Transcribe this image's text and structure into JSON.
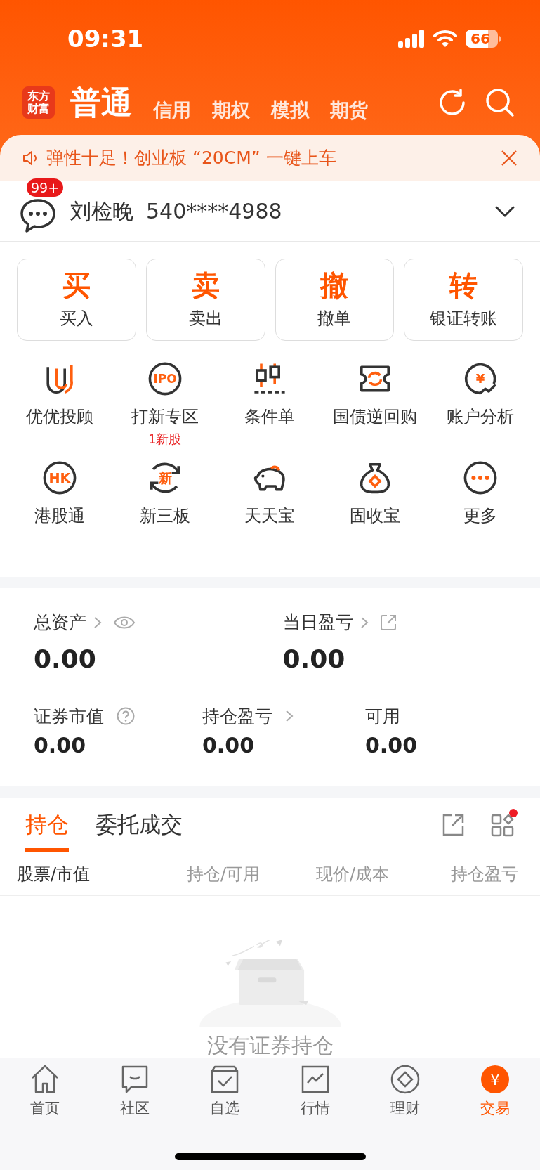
{
  "status_bar": {
    "time": "09:31",
    "battery": "66"
  },
  "account_tabs": [
    {
      "label": "普通",
      "selected": true
    },
    {
      "label": "信用",
      "selected": false
    },
    {
      "label": "期权",
      "selected": false
    },
    {
      "label": "模拟",
      "selected": false
    },
    {
      "label": "期货",
      "selected": false
    }
  ],
  "logo": {
    "line_1": "东方",
    "line_2": "财富"
  },
  "banner": {
    "text": "弹性十足！创业板 “20CM” 一键上车"
  },
  "account": {
    "badge": "99+",
    "name": "刘检晚",
    "number": "540****4988"
  },
  "trade_buttons": [
    {
      "glyph": "买",
      "label": "买入"
    },
    {
      "glyph": "卖",
      "label": "卖出"
    },
    {
      "glyph": "撤",
      "label": "撤单"
    },
    {
      "glyph": "转",
      "label": "银证转账"
    }
  ],
  "services": [
    {
      "label": "优优投顾"
    },
    {
      "label": "打新专区",
      "note": "1新股",
      "icon_text": "IPO"
    },
    {
      "label": "条件单"
    },
    {
      "label": "国债逆回购"
    },
    {
      "label": "账户分析",
      "icon_text": "¥"
    },
    {
      "label": "港股通",
      "icon_text": "HK"
    },
    {
      "label": "新三板",
      "icon_text": "新"
    },
    {
      "label": "天天宝"
    },
    {
      "label": "固收宝"
    },
    {
      "label": "更多"
    }
  ],
  "assets": {
    "top": [
      {
        "label": "总资产",
        "value": "0.00"
      },
      {
        "label": "当日盈亏",
        "value": "0.00"
      }
    ],
    "bottom": [
      {
        "label": "证券市值",
        "value": "0.00"
      },
      {
        "label": "持仓盈亏",
        "value": "0.00"
      },
      {
        "label": "可用",
        "value": "0.00"
      }
    ]
  },
  "holdings_tabs": [
    {
      "label": "持仓",
      "selected": true
    },
    {
      "label": "委托成交",
      "selected": false
    }
  ],
  "table": {
    "columns": [
      "股票/市值",
      "持仓/可用",
      "现价/成本",
      "持仓盈亏"
    ]
  },
  "empty_state": {
    "text": "没有证券持仓"
  },
  "bottom_nav": [
    {
      "label": "首页",
      "selected": false
    },
    {
      "label": "社区",
      "selected": false
    },
    {
      "label": "自选",
      "selected": false
    },
    {
      "label": "行情",
      "selected": false
    },
    {
      "label": "理财",
      "selected": false
    },
    {
      "label": "交易",
      "selected": true,
      "icon_text": "¥"
    }
  ]
}
